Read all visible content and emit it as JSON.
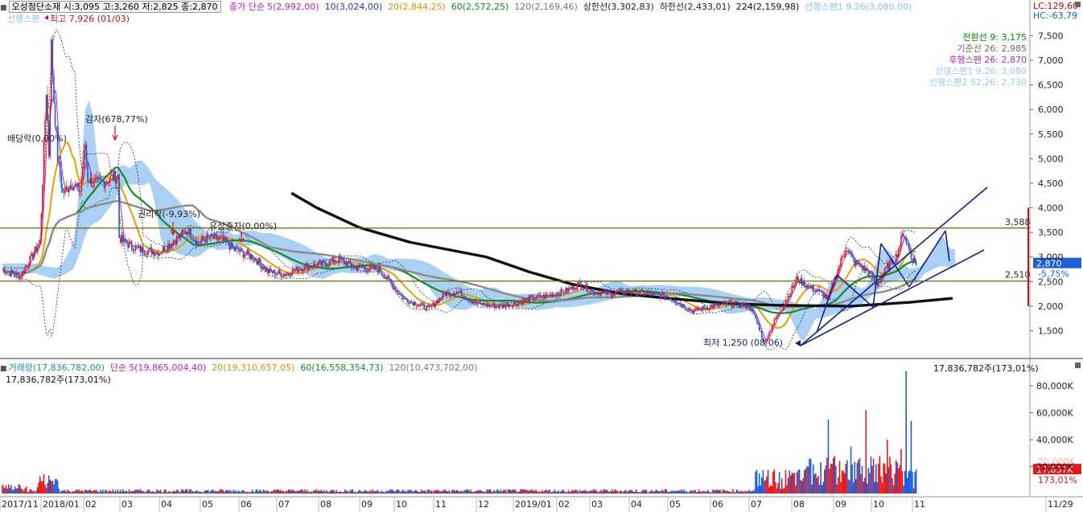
{
  "header": {
    "bullet": "■",
    "stock_info": "오성첨단소재 시:3,095 고:3,260 저:2,825 종:2,870",
    "ma_label": "종가 단순",
    "ma5": "5(2,992,00)",
    "ma10": "10(3,024,00)",
    "ma20": "20(2,844,25)",
    "ma60": "60(2,572,25)",
    "ma120": "120(2,169,46)",
    "upper": "상한선(3,302,83)",
    "lower": "하한선(2,433,01)",
    "ma224": "224(2,159,98)",
    "span": "선행스팬1 9,26(3,080,00)",
    "span_short": "선행스팬"
  },
  "side": {
    "lc": "LC:129,60",
    "hc": "HC:-63,79"
  },
  "ichimoku_legend": [
    {
      "text": "전환선 9: 3,175",
      "color": "#008800"
    },
    {
      "text": "기준선 26: 2,985",
      "color": "#6a6a6a"
    },
    {
      "text": "후행스팬 26: 2,870",
      "color": "#b02cb0"
    },
    {
      "text": "선행스팬1 9,26: 3,080",
      "color": "#9ec8f0"
    },
    {
      "text": "선행스팬2 52,26: 2,730",
      "color": "#9ec8f0"
    }
  ],
  "annotations": {
    "high": "최고 7,926 (01/03)",
    "low": "최저 1,250 (08/06)",
    "dividend": "배당락(0,00%)",
    "reduction": "감자(678,77%)",
    "rights": "권리락(-9,93%)",
    "capital_increase": "유상증자(0,00%)",
    "level_high": "3,588",
    "level_low": "2,510",
    "current_price": "2,870",
    "current_pct": "-5,75%"
  },
  "volume_header": {
    "vol": "거래량(17,836,782,00)",
    "ma_label": "단순",
    "ma5": "5(19,865,004,40)",
    "ma20": "20(19,310,657,05)",
    "ma60": "60(16,558,354,73)",
    "ma120": "120(10,473,702,00)",
    "right": "17,836,782주(173,01%)",
    "left_sub": "17,836,782주(173,01%)",
    "current_vol": "17,837K",
    "current_pct": "173,01%",
    "ghost_label": "20,000K"
  },
  "colors": {
    "up": "#e8191a",
    "down": "#1c5fd8",
    "ma5": "#c020c0",
    "ma20": "#e8a000",
    "ma60": "#138a28",
    "ma120": "#8a8a8a",
    "ma224": "#101010",
    "cloud": "#8ec1f0",
    "trend": "#15208a",
    "level": "#6b6b00"
  },
  "chart_data": {
    "type": "line",
    "title": "오성첨단소재",
    "price_axis": {
      "ticks": [
        1500,
        2000,
        2500,
        3000,
        3500,
        4000,
        4500,
        5000,
        5500,
        6000,
        6500,
        7000,
        7500
      ],
      "tick_labels": [
        "1,500",
        "2,000",
        "2,500",
        "3,000",
        "3,500",
        "4,000",
        "4,500",
        "5,000",
        "5,500",
        "6,000",
        "6,500",
        "7,000",
        "7,500"
      ],
      "range": [
        1000,
        8000
      ]
    },
    "volume_axis": {
      "ticks": [
        20000,
        40000,
        60000,
        80000
      ],
      "tick_labels": [
        "20,000K",
        "40,000K",
        "60,000K",
        "80,000K"
      ],
      "unit": "K"
    },
    "x_labels": [
      "2017/11",
      "2018/01",
      "02",
      "03",
      "04",
      "05",
      "06",
      "07",
      "08",
      "09",
      "10",
      "11",
      "12",
      "2019/01",
      "02",
      "03",
      "04",
      "05",
      "06",
      "07",
      "08",
      "09",
      "10",
      "11",
      "11/29"
    ],
    "key_points": [
      {
        "date": "2017/11",
        "close": 2700
      },
      {
        "date": "2018/01/03",
        "high": 7926
      },
      {
        "date": "2018/02",
        "close": 4300
      },
      {
        "date": "2018/03",
        "close": 3300
      },
      {
        "date": "2018/04",
        "close": 3100
      },
      {
        "date": "2018/05",
        "close": 3400
      },
      {
        "date": "2018/06",
        "close": 3100
      },
      {
        "date": "2018/07",
        "close": 2600
      },
      {
        "date": "2018/08",
        "close": 2700
      },
      {
        "date": "2018/09",
        "close": 2800
      },
      {
        "date": "2018/10",
        "close": 2300
      },
      {
        "date": "2018/11",
        "close": 2000
      },
      {
        "date": "2018/12",
        "close": 2000
      },
      {
        "date": "2019/01",
        "close": 2100
      },
      {
        "date": "2019/03",
        "close": 2450
      },
      {
        "date": "2019/05",
        "close": 2250
      },
      {
        "date": "2019/06",
        "close": 2000
      },
      {
        "date": "2019/08/06",
        "low": 1250
      },
      {
        "date": "2019/09",
        "close": 2600
      },
      {
        "date": "2019/10",
        "close": 3200
      },
      {
        "date": "2019/11",
        "close": 2870
      }
    ],
    "ma224_points": [
      [
        3400,
        4300
      ],
      [
        3700,
        4000
      ],
      [
        4200,
        3600
      ],
      [
        4800,
        3300
      ],
      [
        5700,
        3000
      ],
      [
        6200,
        2700
      ],
      [
        6700,
        2450
      ],
      [
        7300,
        2250
      ],
      [
        7900,
        2150
      ],
      [
        8600,
        2050
      ],
      [
        9100,
        2020
      ],
      [
        10000,
        2000
      ],
      [
        10700,
        2080
      ],
      [
        11200,
        2160
      ]
    ],
    "volume_bars": [
      {
        "date": "2018/01",
        "value": 15000
      },
      {
        "date": "2018/02",
        "value": 10000
      },
      {
        "date": "2018/05",
        "value": 7000
      },
      {
        "date": "2019/09",
        "value": 55000
      },
      {
        "date": "2019/10",
        "value": 62000
      },
      {
        "date": "2019/11/06",
        "value": 40000
      },
      {
        "date": "2019/11/20",
        "value": 91000
      },
      {
        "date": "2019/11/29",
        "value": 17837
      }
    ]
  }
}
